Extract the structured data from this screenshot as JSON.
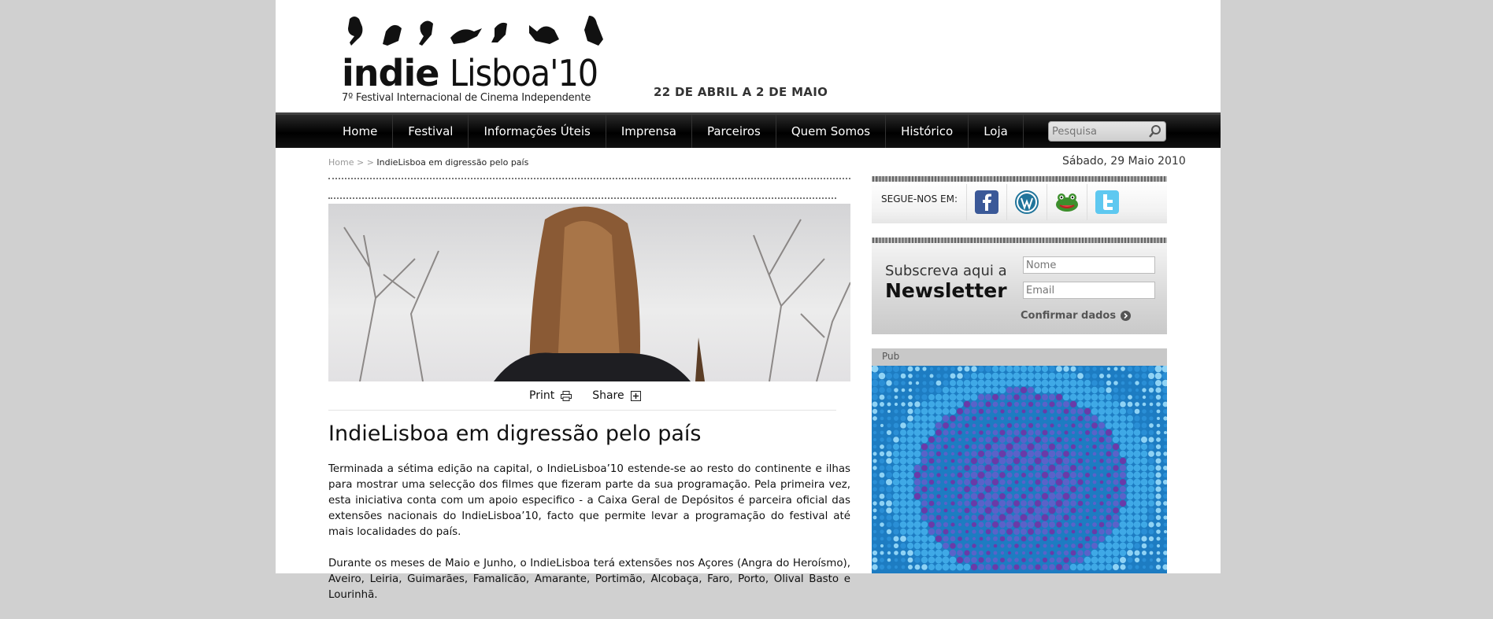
{
  "header": {
    "logo_indie": "indie",
    "logo_lisboa": "Lisboa'10",
    "logo_subtitle": "7º Festival Internacional de Cinema Independente",
    "dates": "22 DE ABRIL A 2 DE MAIO"
  },
  "nav": {
    "items": [
      "Home",
      "Festival",
      "Informações Úteis",
      "Imprensa",
      "Parceiros",
      "Quem Somos",
      "Histórico",
      "Loja"
    ],
    "search_placeholder": "Pesquisa"
  },
  "breadcrumb": {
    "home": "Home",
    "sep": " > > ",
    "current": "IndieLisboa em digressão pelo país"
  },
  "today": "Sábado, 29 Maio 2010",
  "article": {
    "print_label": "Print",
    "share_label": "Share",
    "title": "IndieLisboa em digressão pelo país",
    "paragraphs": [
      "Terminada a sétima edição na capital, o IndieLisboa’10 estende-se ao resto do continente e ilhas para mostrar uma selecção dos filmes que fizeram parte da sua programação. Pela primeira vez, esta iniciativa conta com um apoio especifico - a Caixa Geral de Depósitos é parceira oficial das extensões nacionais do IndieLisboa’10, facto que permite levar a programação do festival até mais localidades do país.",
      "Durante os meses de Maio e Junho, o IndieLisboa terá extensões nos Açores (Angra do Heroísmo), Aveiro, Leiria, Guimarães, Famalicão, Amarante, Portimão, Alcobaça, Faro, Porto, Olival Basto e Lourinhã."
    ]
  },
  "sidebar": {
    "follow_label": "SEGUE-NOS EM:",
    "social_icons": [
      "facebook-icon",
      "wordpress-icon",
      "myspace-frog-icon",
      "twitter-icon"
    ],
    "newsletter_line1": "Subscreva aqui a",
    "newsletter_line2": "Newsletter",
    "name_placeholder": "Nome",
    "email_placeholder": "Email",
    "confirm_label": "Confirmar dados",
    "pub_label": "Pub"
  },
  "colors": {
    "nav_bg": "#000000",
    "page_bg": "#d0d0d0",
    "facebook": "#3b5998",
    "twitter": "#5ec8f0"
  }
}
